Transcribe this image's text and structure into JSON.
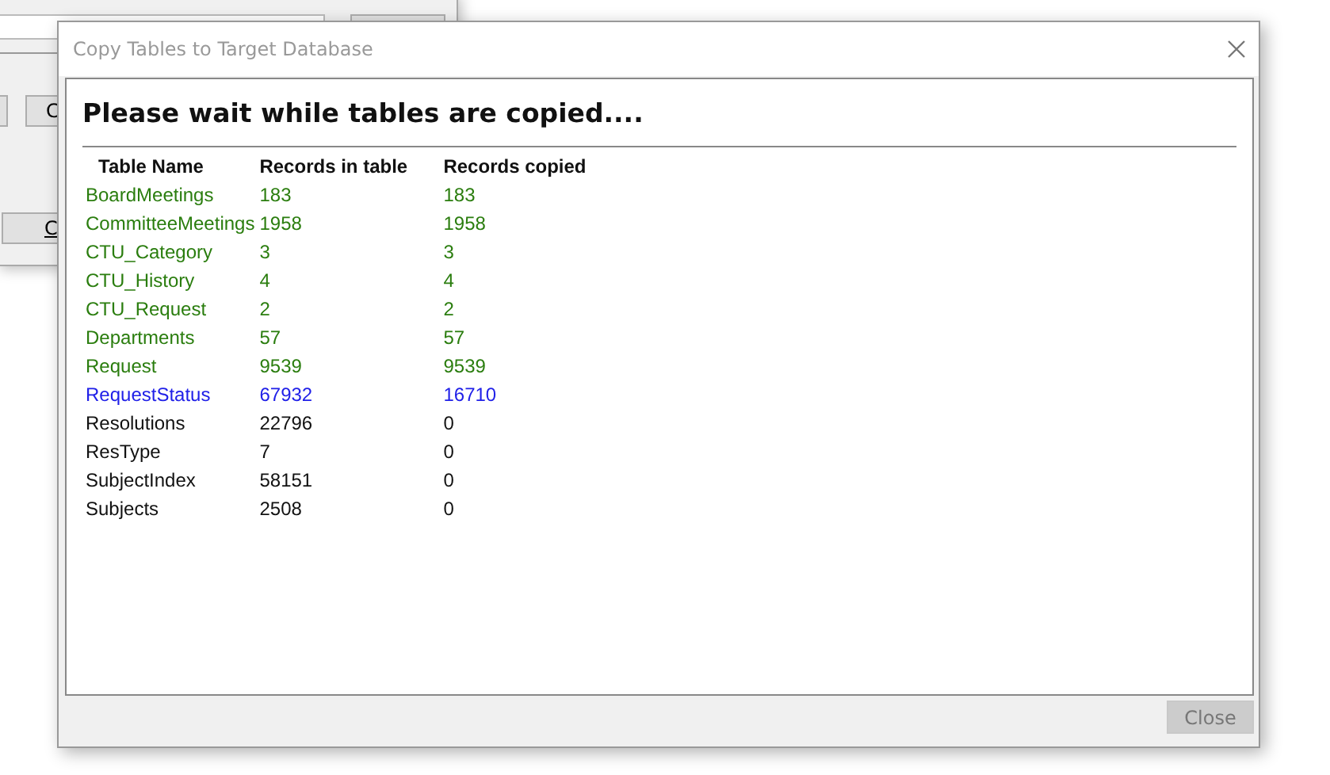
{
  "background_window": {
    "buttons": [
      {
        "label": "C"
      },
      {
        "label": "C"
      }
    ]
  },
  "window": {
    "title": "Copy Tables to Target Database"
  },
  "heading": "Please wait while tables are copied....",
  "table": {
    "columns": [
      "Table Name",
      "Records in table",
      "Records copied"
    ],
    "rows": [
      {
        "name": "BoardMeetings",
        "in_table": "183",
        "copied": "183",
        "color": "#2a7d0e"
      },
      {
        "name": "CommitteeMeetings",
        "in_table": "1958",
        "copied": "1958",
        "color": "#2a7d0e"
      },
      {
        "name": "CTU_Category",
        "in_table": "3",
        "copied": "3",
        "color": "#2a7d0e"
      },
      {
        "name": "CTU_History",
        "in_table": "4",
        "copied": "4",
        "color": "#2a7d0e"
      },
      {
        "name": "CTU_Request",
        "in_table": "2",
        "copied": "2",
        "color": "#2a7d0e"
      },
      {
        "name": "Departments",
        "in_table": "57",
        "copied": "57",
        "color": "#2a7d0e"
      },
      {
        "name": "Request",
        "in_table": "9539",
        "copied": "9539",
        "color": "#2a7d0e"
      },
      {
        "name": "RequestStatus",
        "in_table": "67932",
        "copied": "16710",
        "color": "#2020e8"
      },
      {
        "name": "Resolutions",
        "in_table": "22796",
        "copied": "0",
        "color": "#111111"
      },
      {
        "name": "ResType",
        "in_table": "7",
        "copied": "0",
        "color": "#111111"
      },
      {
        "name": "SubjectIndex",
        "in_table": "58151",
        "copied": "0",
        "color": "#111111"
      },
      {
        "name": "Subjects",
        "in_table": "2508",
        "copied": "0",
        "color": "#111111"
      }
    ]
  },
  "close_button": {
    "label": "Close",
    "disabled": true
  }
}
